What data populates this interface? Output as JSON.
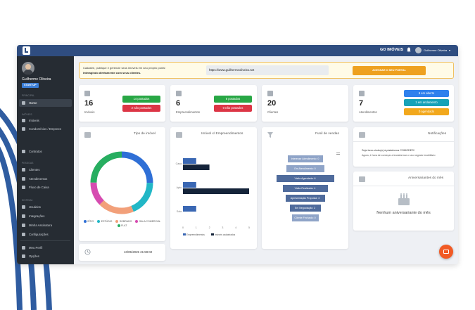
{
  "app": {
    "brand": "GO IMÓVEIS",
    "user_name": "Guilherme Oliveira"
  },
  "sidebar": {
    "user_name": "Guilherme Oliveira",
    "plan": "STARTUP",
    "sections": [
      "PRINCIPAL",
      "IMÓVEIS",
      "PESSOAS",
      "SISTEMA"
    ],
    "items": [
      {
        "label": "Home"
      },
      {
        "label": "Imóveis"
      },
      {
        "label": "Condomínios / Emprees"
      },
      {
        "label": "Contratos"
      },
      {
        "label": "Clientes"
      },
      {
        "label": "Atendimentos"
      },
      {
        "label": "Fluxo de Caixa"
      },
      {
        "label": "Usuários"
      },
      {
        "label": "Integrações"
      },
      {
        "label": "Minha Assinatura"
      },
      {
        "label": "Configurações"
      },
      {
        "label": "Meu Perfil"
      },
      {
        "label": "Opções"
      }
    ]
  },
  "banner": {
    "line1": "Cadastre, publique e gerencie seus imóveis em seu próprio portal",
    "line2": "interagindo diretamente com seus clientes.",
    "url": "https://www.guilhermeoliveira.net",
    "cta": "ACESSAR O SEU PORTAL"
  },
  "stats": [
    {
      "value": "16",
      "label": "Imóveis",
      "pills": [
        {
          "text": "14 postados",
          "color": "#28a745"
        },
        {
          "text": "2 não postados",
          "color": "#dc3545"
        }
      ]
    },
    {
      "value": "6",
      "label": "Empreendimentos",
      "pills": [
        {
          "text": "6 postados",
          "color": "#28a745"
        },
        {
          "text": "0 não postados",
          "color": "#dc3545"
        }
      ]
    },
    {
      "value": "20",
      "label": "Clientes",
      "pills": []
    },
    {
      "value": "7",
      "label": "Atendimentos",
      "pills": [
        {
          "text": "6 em aberto",
          "color": "#2f80ed"
        },
        {
          "text": "1 em andamento",
          "color": "#17a2b8"
        },
        {
          "text": "0 agendado",
          "color": "#f2a81d"
        }
      ]
    }
  ],
  "panels": {
    "tipo": "Tipo de imóvel",
    "empre": "Imóvel x/ Empreendimentos",
    "funil": "Funil de vendas",
    "notif": "Notificações",
    "aniv": "Aniversariantes do mês",
    "aniv_empty": "Nenhum aniversariante do mês"
  },
  "notification": {
    "line1": "Seja bem-vindo(a) à plataforma COMODES!",
    "line2": "Agora, é hora de começar a transformar o seu negócio imobiliário"
  },
  "clock": {
    "datetime": "10/05/2025 21:59:02"
  },
  "colors": {
    "topbar": "#2f4d80",
    "sidebar": "#262c33",
    "bar_primary": "#3a67b3",
    "bar_dark": "#15243a",
    "funnel": "#4f6b9c"
  },
  "chart_data": [
    {
      "type": "pie",
      "title": "Tipo de imóvel",
      "labels": [
        "SÍTIO",
        "ESTÚDIO",
        "SOBRADO",
        "SALA COMERCIAL",
        "FLAT"
      ],
      "values": [
        4,
        3,
        3,
        2,
        4
      ],
      "colors": [
        "#2f6fd6",
        "#22b7c6",
        "#f2a07a",
        "#d64bb0",
        "#27ae60"
      ]
    },
    {
      "type": "bar",
      "orientation": "horizontal",
      "categories": [
        "Casa",
        "Apto",
        "Sala"
      ],
      "series": [
        {
          "name": "Empreendimentos",
          "values": [
            1,
            1,
            1
          ]
        },
        {
          "name": "Imóveis cadastrados",
          "values": [
            2,
            5,
            0
          ]
        }
      ],
      "xticks": [
        "0",
        "1",
        "2",
        "3",
        "4",
        "5"
      ],
      "xlim": [
        0,
        5
      ]
    },
    {
      "type": "bar",
      "orientation": "funnel",
      "title": "Funil de vendas",
      "stages": [
        "Interesse Atendimento: 0",
        "Em Atendimento: 0",
        "Visita Agendada: 6",
        "Visita Realizada: 4",
        "Apresentação Proposta: 3",
        "Em Negociação: 2",
        "Cliente Fechado: 0"
      ],
      "values": [
        0,
        0,
        6,
        4,
        3,
        2,
        0
      ]
    }
  ]
}
